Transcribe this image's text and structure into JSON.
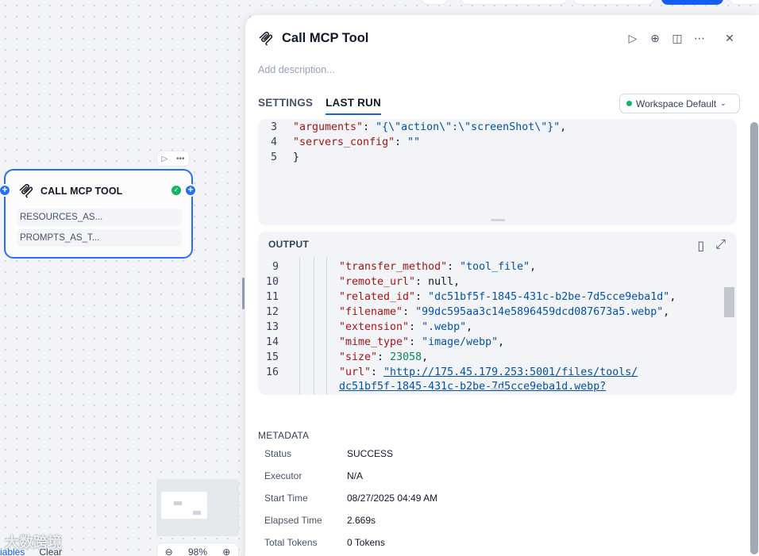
{
  "canvas": {
    "node": {
      "title": "CALL MCP TOOL",
      "items": [
        "RESOURCES_AS...",
        "PROMPTS_AS_T..."
      ]
    },
    "zoom": "98%",
    "bottom_links": [
      "iables",
      "Clear"
    ],
    "watermark": "大数跨境"
  },
  "panel": {
    "title": "Call MCP Tool",
    "description_placeholder": "Add description...",
    "tabs": [
      "SETTINGS",
      "LAST RUN"
    ],
    "active_tab": "LAST RUN",
    "workspace_select": "Workspace Default",
    "input_code": [
      {
        "n": "3",
        "key": "\"arguments\"",
        "sep": ": ",
        "val": "\"{\\\"action\\\":\\\"screenShot\\\"}\"",
        "tail": ","
      },
      {
        "n": "4",
        "key": "\"servers_config\"",
        "sep": ": ",
        "val": "\"\"",
        "tail": ""
      },
      {
        "n": "5",
        "key": "",
        "sep": "}",
        "val": "",
        "tail": ""
      }
    ],
    "output": {
      "label": "OUTPUT",
      "lines": [
        {
          "n": "9",
          "key": "\"transfer_method\"",
          "val": "\"tool_file\"",
          "type": "str",
          "tail": ","
        },
        {
          "n": "10",
          "key": "\"remote_url\"",
          "val": "null",
          "type": "pun",
          "tail": ","
        },
        {
          "n": "11",
          "key": "\"related_id\"",
          "val": "\"dc51bf5f-1845-431c-b2be-7d5cce9eba1d\"",
          "type": "str",
          "tail": ","
        },
        {
          "n": "12",
          "key": "\"filename\"",
          "val": "\"99dc595aa3c14e5896459dcd087673a5.webp\"",
          "type": "str",
          "tail": ","
        },
        {
          "n": "13",
          "key": "\"extension\"",
          "val": "\".webp\"",
          "type": "str",
          "tail": ","
        },
        {
          "n": "14",
          "key": "\"mime_type\"",
          "val": "\"image/webp\"",
          "type": "str",
          "tail": ","
        },
        {
          "n": "15",
          "key": "\"size\"",
          "val": "23058",
          "type": "num",
          "tail": ","
        },
        {
          "n": "16",
          "key": "\"url\"",
          "val": "\"http://175.45.179.253:5001/files/tools/",
          "type": "url",
          "tail": ""
        }
      ],
      "wrap_line": "dc51bf5f-1845-431c-b2be-7d5cce9eba1d.webp?"
    },
    "metadata": {
      "title": "METADATA",
      "rows": [
        {
          "label": "Status",
          "value": "SUCCESS"
        },
        {
          "label": "Executor",
          "value": "N/A"
        },
        {
          "label": "Start Time",
          "value": "08/27/2025 04:49 AM"
        },
        {
          "label": "Elapsed Time",
          "value": "2.669s"
        },
        {
          "label": "Total Tokens",
          "value": "0 Tokens"
        }
      ]
    }
  }
}
